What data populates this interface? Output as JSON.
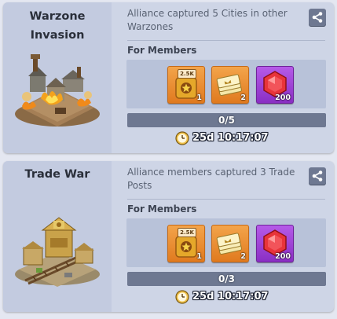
{
  "events": [
    {
      "title_line1": "Warzone",
      "title_line2": "Invasion",
      "description": "Alliance captured 5 Cities in other Warzones",
      "members_label": "For Members",
      "rewards": [
        {
          "icon": "badge-icon",
          "tag": "2.5K",
          "quantity": "1",
          "rarity": "orange"
        },
        {
          "icon": "ticket-stack-icon",
          "quantity": "2",
          "rarity": "orange"
        },
        {
          "icon": "red-gem-icon",
          "quantity": "200",
          "rarity": "purple"
        }
      ],
      "progress_text": "0/5",
      "progress_fraction": 0,
      "timer": "25d 10:17:07"
    },
    {
      "title_line1": "Trade War",
      "description": "Alliance members captured 3 Trade Posts",
      "members_label": "For Members",
      "rewards": [
        {
          "icon": "badge-icon",
          "tag": "2.5K",
          "quantity": "1",
          "rarity": "orange"
        },
        {
          "icon": "ticket-stack-icon",
          "quantity": "2",
          "rarity": "orange"
        },
        {
          "icon": "red-gem-icon",
          "quantity": "200",
          "rarity": "purple"
        }
      ],
      "progress_text": "0/3",
      "progress_fraction": 0,
      "timer": "25d 10:17:07"
    }
  ],
  "colors": {
    "card": "#ced5e6",
    "left_panel": "#c3cbe0",
    "progress_track": "#6e7891",
    "reward_orange": "#e98d30",
    "reward_purple": "#9b40d4"
  }
}
